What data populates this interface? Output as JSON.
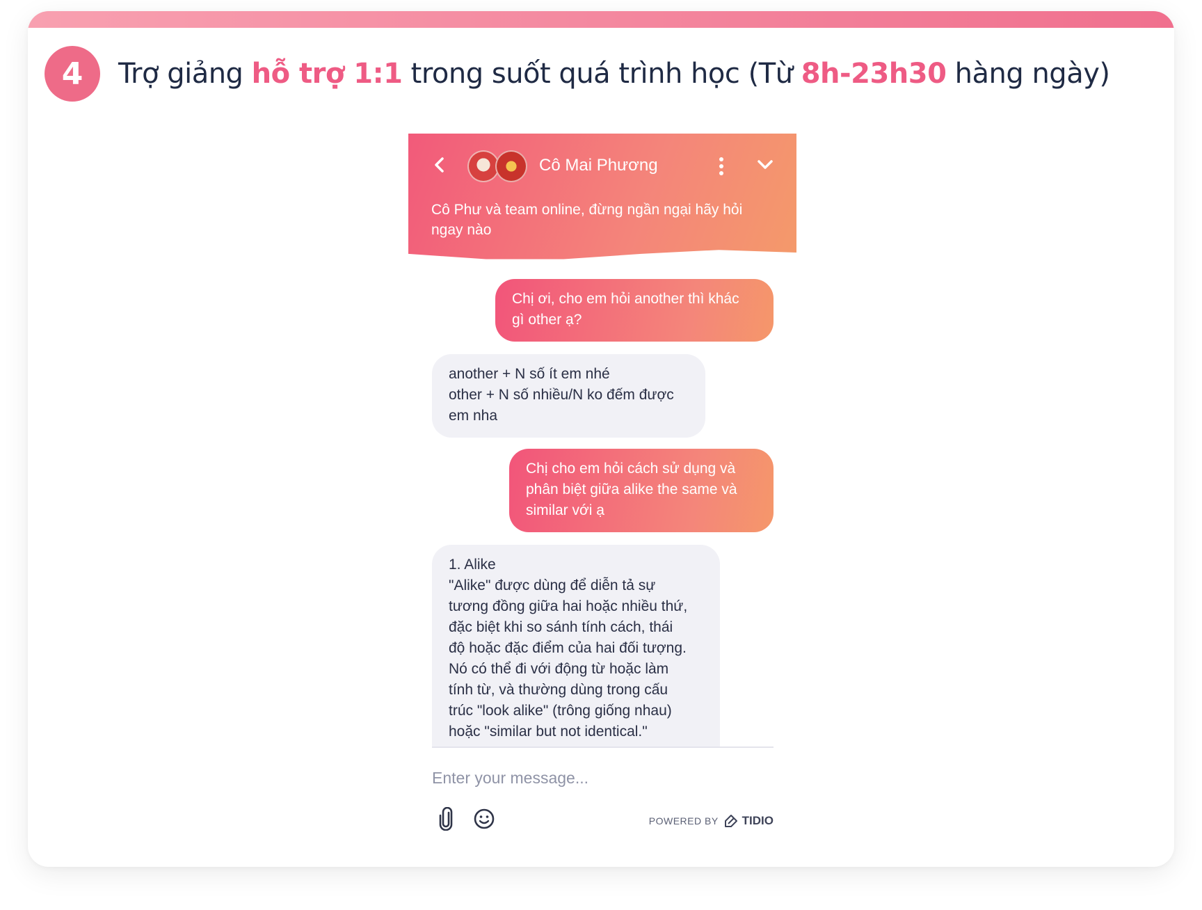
{
  "heading": {
    "step": "4",
    "text_before": "Trợ giảng ",
    "highlight_1": "hỗ trợ 1:1",
    "text_middle": " trong suốt quá trình học (Từ ",
    "highlight_2": "8h-23h30",
    "text_after": " hàng ngày)"
  },
  "chat": {
    "agent_name": "Cô Mai Phương",
    "header_subtitle": "Cô Phư và team online, đừng ngần ngại hãy hỏi ngay nào",
    "messages": [
      {
        "from": "user",
        "lines": [
          "Chị ơi, cho em hỏi another thì khác",
          "gì other ạ?"
        ]
      },
      {
        "from": "agent",
        "lines": [
          "another + N số ít em nhé",
          "other + N số nhiều/N ko đếm được",
          "em nha"
        ]
      },
      {
        "from": "user",
        "lines": [
          "Chị cho em hỏi cách sử dụng và",
          "phân biệt giữa alike the same và",
          "similar với ạ"
        ]
      },
      {
        "from": "agent",
        "lines": [
          "1. Alike",
          "\"Alike\" được dùng để diễn tả sự",
          "tương đồng giữa hai hoặc nhiều thứ,",
          "đặc biệt khi so sánh tính cách, thái",
          "độ hoặc đặc điểm của hai đối tượng.",
          "Nó có thể đi với động từ hoặc làm",
          "tính từ, và thường dùng trong cấu",
          "trúc \"look alike\" (trông giống nhau)",
          "hoặc \"similar but not identical.\""
        ]
      }
    ],
    "input_placeholder": "Enter your message...",
    "powered_by": "POWERED BY",
    "brand": "TIDIO"
  },
  "colors": {
    "accent": "#ee5b84",
    "header_gradient_start": "#f25a7a",
    "header_gradient_end": "#f49a6a",
    "agent_bubble": "#f1f1f6",
    "heading_text": "#1f2a44"
  },
  "icons": [
    "back-chevron-icon",
    "more-vertical-icon",
    "chevron-down-icon",
    "paperclip-icon",
    "emoji-icon",
    "tidio-logo-icon"
  ]
}
